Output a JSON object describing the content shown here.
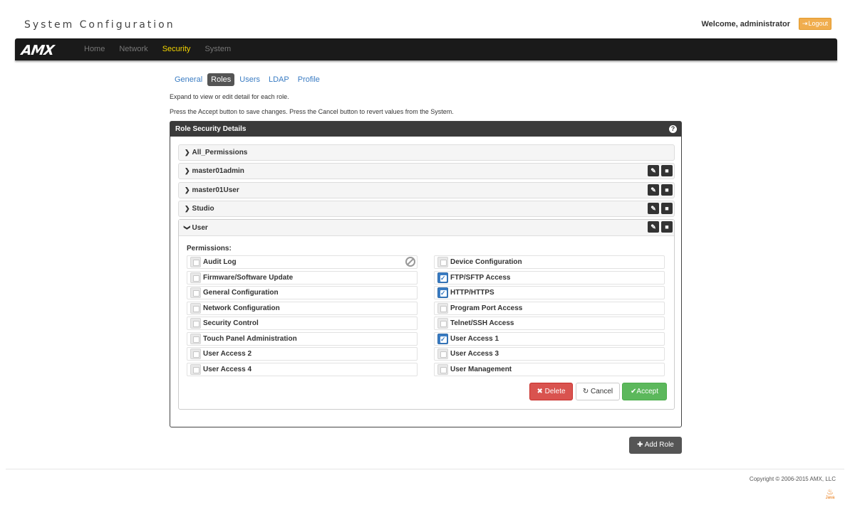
{
  "app": {
    "title": "System Configuration",
    "welcome": "Welcome, administrator",
    "logout_label": "Logout"
  },
  "nav": {
    "logo": "AMX",
    "items": [
      "Home",
      "Network",
      "Security",
      "System"
    ],
    "active": "Security"
  },
  "subtabs": {
    "items": [
      "General",
      "Roles",
      "Users",
      "LDAP",
      "Profile"
    ],
    "active": "Roles"
  },
  "help": {
    "line1": "Expand to view or edit detail for each role.",
    "line2": "Press the Accept button to save changes. Press the Cancel button to revert values from the System."
  },
  "panel": {
    "title": "Role Security Details",
    "roles": [
      "All_Permissions",
      "master01admin",
      "master01User",
      "Studio",
      "User"
    ],
    "expanded_role": "User",
    "permissions_label": "Permissions:",
    "permissions": [
      {
        "label": "Audit Log",
        "checked": false,
        "restricted": true
      },
      {
        "label": "Device Configuration",
        "checked": false
      },
      {
        "label": "Firmware/Software Update",
        "checked": false
      },
      {
        "label": "FTP/SFTP Access",
        "checked": true
      },
      {
        "label": "General Configuration",
        "checked": false
      },
      {
        "label": "HTTP/HTTPS",
        "checked": true
      },
      {
        "label": "Network Configuration",
        "checked": false
      },
      {
        "label": "Program Port Access",
        "checked": false
      },
      {
        "label": "Security Control",
        "checked": false
      },
      {
        "label": "Telnet/SSH Access",
        "checked": false
      },
      {
        "label": "Touch Panel Administration",
        "checked": false
      },
      {
        "label": "User Access 1",
        "checked": true
      },
      {
        "label": "User Access 2",
        "checked": false
      },
      {
        "label": "User Access 3",
        "checked": false
      },
      {
        "label": "User Access 4",
        "checked": false
      },
      {
        "label": "User Management",
        "checked": false
      }
    ],
    "buttons": {
      "delete": "Delete",
      "cancel": "Cancel",
      "accept": "Accept"
    }
  },
  "add_role_label": "Add Role",
  "footer": {
    "copyright": "Copyright © 2006-2015 AMX, LLC",
    "java_label": "Java"
  },
  "colors": {
    "accent": "#f5d600",
    "link": "#3a7cc3",
    "danger": "#d9534f",
    "success": "#5cb85c",
    "logout": "#f0ad4e"
  }
}
